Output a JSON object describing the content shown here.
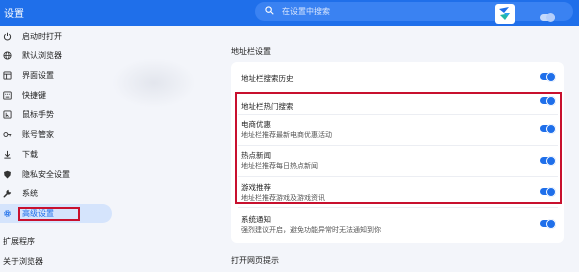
{
  "app": {
    "title": "设置",
    "search_placeholder": "在设置中搜索",
    "logo_icon": "browser-logo-icon",
    "colors": {
      "accent": "#1f6fea",
      "highlight_border": "#c8102e",
      "background": "#f3f5fa",
      "card": "#ffffff"
    }
  },
  "sidebar": {
    "items": [
      {
        "label": "启动时打开",
        "icon": "power-icon"
      },
      {
        "label": "默认浏览器",
        "icon": "globe-icon"
      },
      {
        "label": "界面设置",
        "icon": "layout-icon"
      },
      {
        "label": "快捷键",
        "icon": "keyboard-icon"
      },
      {
        "label": "鼠标手势",
        "icon": "mouse-icon"
      },
      {
        "label": "账号管家",
        "icon": "key-icon"
      },
      {
        "label": "下载",
        "icon": "download-icon"
      },
      {
        "label": "隐私安全设置",
        "icon": "shield-icon"
      },
      {
        "label": "系统",
        "icon": "wrench-icon"
      },
      {
        "label": "高级设置",
        "icon": "gear-icon",
        "active": true
      }
    ],
    "extensions_label": "扩展程序",
    "about_label": "关于浏览器"
  },
  "main": {
    "section_title": "地址栏设置",
    "rows": [
      {
        "title": "地址栏搜索历史",
        "desc": "",
        "enabled": true
      },
      {
        "title": "地址栏热门搜索",
        "desc": "",
        "enabled": true
      },
      {
        "title": "电商优惠",
        "desc": "地址栏推荐最新电商优惠活动",
        "enabled": true
      },
      {
        "title": "热点新闻",
        "desc": "地址栏推荐每日热点新闻",
        "enabled": true
      },
      {
        "title": "游戏推荐",
        "desc": "地址栏推荐游戏及游戏资讯",
        "enabled": true
      },
      {
        "title": "系统通知",
        "desc": "强烈建议开启，避免功能异常时无法通知到你",
        "enabled": true
      }
    ],
    "next_section_title": "打开网页提示"
  }
}
